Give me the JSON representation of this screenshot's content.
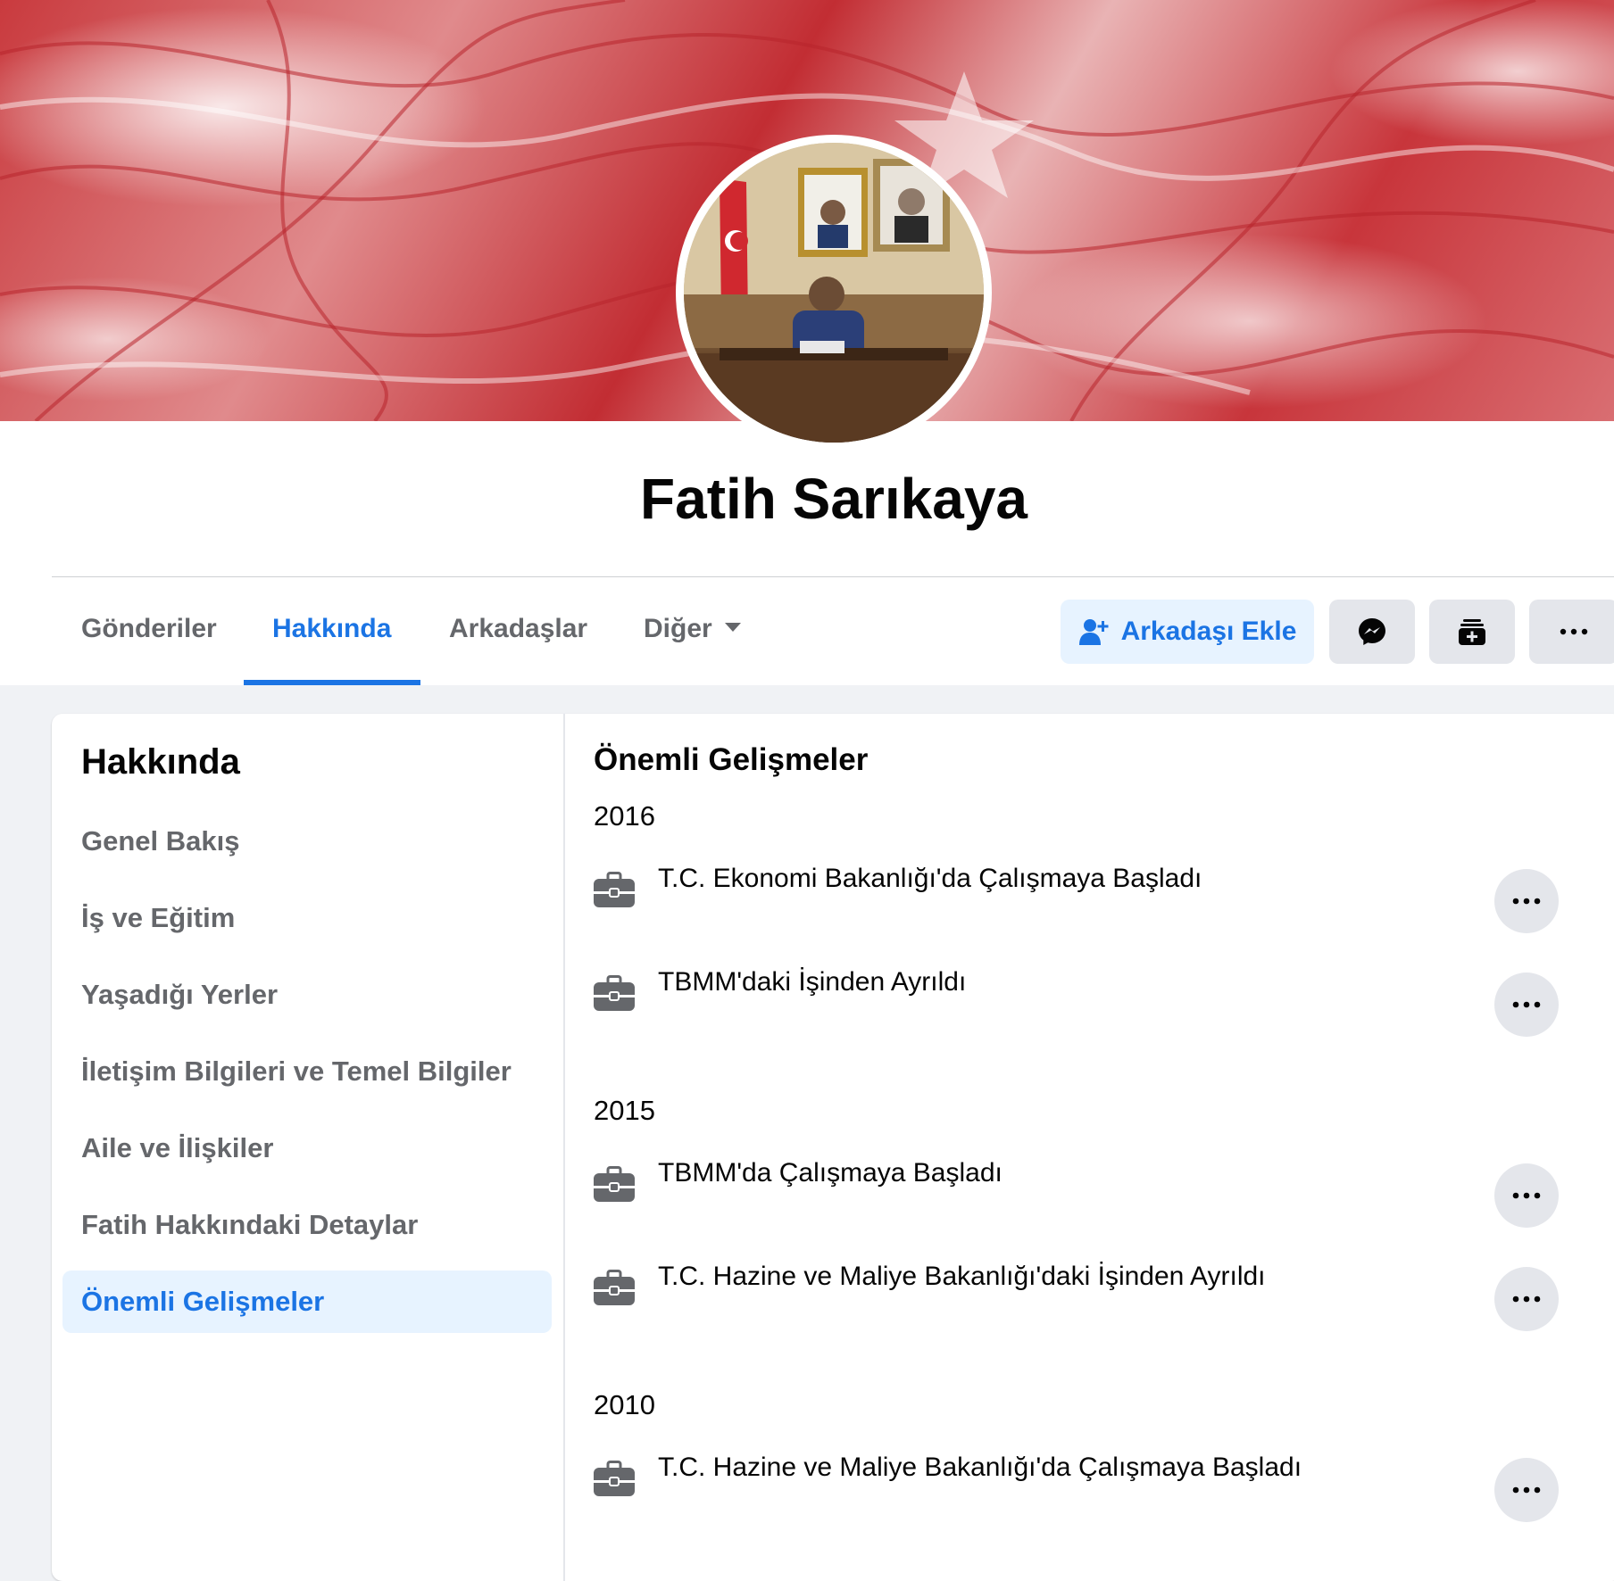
{
  "profile": {
    "name": "Fatih Sarıkaya"
  },
  "tabs": [
    {
      "label": "Gönderiler",
      "active": false
    },
    {
      "label": "Hakkında",
      "active": true
    },
    {
      "label": "Arkadaşlar",
      "active": false
    },
    {
      "label": "Diğer",
      "active": false
    }
  ],
  "actions": {
    "add_friend_label": "Arkadaşı Ekle",
    "add_friend_icon": "add-user-icon",
    "message_icon": "messenger-icon",
    "stack_icon": "add-to-story-icon",
    "more_icon": "more-dots-icon"
  },
  "sidebar": {
    "title": "Hakkında",
    "items": [
      {
        "label": "Genel Bakış"
      },
      {
        "label": "İş ve Eğitim"
      },
      {
        "label": "Yaşadığı Yerler"
      },
      {
        "label": "İletişim Bilgileri ve Temel Bilgiler"
      },
      {
        "label": "Aile ve İlişkiler"
      },
      {
        "label": "Fatih Hakkındaki Detaylar"
      },
      {
        "label": "Önemli Gelişmeler"
      }
    ],
    "active_item": "Önemli Gelişmeler"
  },
  "main": {
    "title": "Önemli Gelişmeler",
    "groups": [
      {
        "year": "2016",
        "events": [
          {
            "text": "T.C. Ekonomi Bakanlığı'da Çalışmaya Başladı",
            "icon": "briefcase-icon"
          },
          {
            "text": "TBMM'daki İşinden Ayrıldı",
            "icon": "briefcase-icon"
          }
        ]
      },
      {
        "year": "2015",
        "events": [
          {
            "text": "TBMM'da Çalışmaya Başladı",
            "icon": "briefcase-icon"
          },
          {
            "text": "T.C. Hazine ve Maliye Bakanlığı'daki İşinden Ayrıldı",
            "icon": "briefcase-icon"
          }
        ]
      },
      {
        "year": "2010",
        "events": [
          {
            "text": "T.C. Hazine ve Maliye Bakanlığı'da Çalışmaya Başladı",
            "icon": "briefcase-icon"
          }
        ]
      }
    ]
  },
  "colors": {
    "accent": "#1b74e4",
    "accent_light": "#e7f3ff",
    "secondary_text": "#65676b",
    "button_gray": "#e4e6eb",
    "page_bg": "#f0f2f5",
    "cover_red": "#c93a3e"
  }
}
